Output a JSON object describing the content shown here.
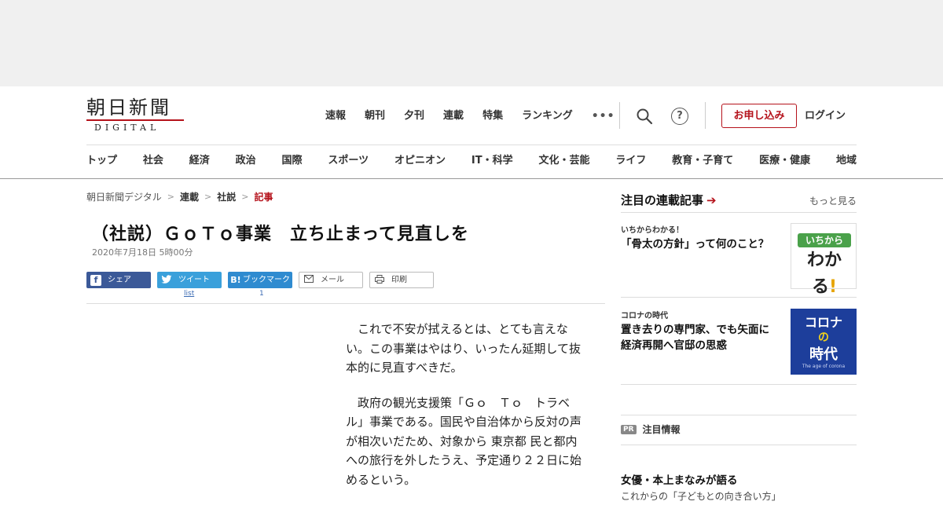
{
  "header": {
    "logo_main": "朝日新聞",
    "logo_sub": "DIGITAL",
    "top_nav": [
      "速報",
      "朝刊",
      "夕刊",
      "連載",
      "特集",
      "ランキング"
    ],
    "more_label": "•••",
    "help_label": "?",
    "apply_label": "お申し込み",
    "login_label": "ログイン",
    "categories": [
      "トップ",
      "社会",
      "経済",
      "政治",
      "国際",
      "スポーツ",
      "オピニオン",
      "IT・科学",
      "文化・芸能",
      "ライフ",
      "教育・子育て",
      "医療・健康",
      "地域"
    ]
  },
  "breadcrumb": {
    "items": [
      "朝日新聞デジタル",
      "連載",
      "社説",
      "記事"
    ],
    "separator": ">"
  },
  "article": {
    "title": "（社説）ＧｏＴｏ事業　立ち止まって見直しを",
    "date": "2020年7月18日 5時00分",
    "share": {
      "facebook": "シェア",
      "twitter": "ツイート",
      "hatena": "ブックマーク",
      "mail": "メール",
      "print": "印刷",
      "twitter_count": "list",
      "hatena_count": "1"
    },
    "paragraphs": [
      "これで不安が拭えるとは、とても言えない。この事業はやはり、いったん延期して抜本的に見直すべきだ。",
      "政府の観光支援策「Ｇｏ　Ｔｏ　トラベル」事業である。国民や自治体から反対の声が相次いだため、対象から 東京都 民と都内への旅行を外したうえ、予定通り２２日に始めるという。"
    ]
  },
  "sidebar": {
    "title": "注目の連載記事",
    "more": "もっと見る",
    "series": [
      {
        "label": "いちからわかる！",
        "title": "「骨太の方針」って何のこと？",
        "thumb_top": "いちから",
        "thumb_big": "わかる",
        "thumb_bang": "!"
      },
      {
        "label": "コロナの時代",
        "title": "置き去りの専門家、でも矢面に　経済再開へ官邸の思惑",
        "thumb_l1": "コロナ",
        "thumb_l2": "の",
        "thumb_l3": "時代",
        "thumb_l4": "The age of corona"
      }
    ],
    "pr_badge": "PR",
    "pr_label": "注目情報",
    "promo_title": "女優・本上まなみが語る",
    "promo_sub": "これからの「子どもとの向き合い方」"
  },
  "colors": {
    "brand_red": "#b5121b",
    "facebook": "#3b5998",
    "twitter": "#3aa0db",
    "hatena": "#2f8bd0"
  }
}
